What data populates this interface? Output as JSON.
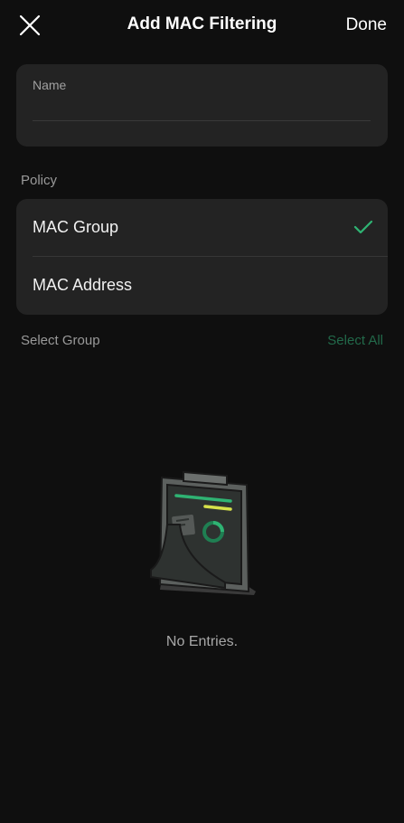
{
  "nav": {
    "title": "Add MAC Filtering",
    "done_label": "Done",
    "close_icon": "close-icon"
  },
  "name_field": {
    "label": "Name",
    "value": ""
  },
  "policy": {
    "section_label": "Policy",
    "options": [
      {
        "label": "MAC Group",
        "selected": true
      },
      {
        "label": "MAC Address",
        "selected": false
      }
    ]
  },
  "group": {
    "section_label": "Select Group",
    "select_all_label": "Select All"
  },
  "empty_state": {
    "icon": "clipboard-empty-icon",
    "text": "No Entries."
  },
  "colors": {
    "background": "#0f0f0f",
    "card": "#232323",
    "accent": "#2fb373",
    "accent_muted": "#22694a",
    "highlight_yellow": "#d6e14a"
  }
}
